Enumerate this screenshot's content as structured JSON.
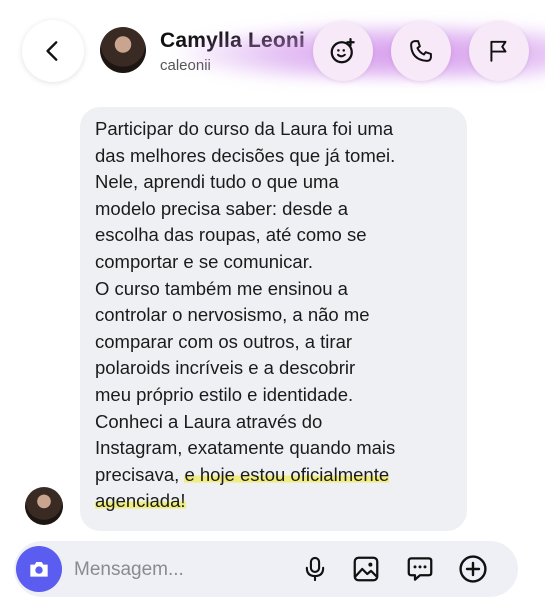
{
  "header": {
    "name": "Camylla Leoni",
    "username": "caleonii"
  },
  "message": {
    "text": "Participar do curso da Laura foi uma\ndas melhores decisões que já tomei.\nNele, aprendi tudo o que uma\nmodelo precisa saber: desde a\nescolha das roupas, até como se\ncomportar e se comunicar.\nO curso também me ensinou a\ncontrolar o nervosismo, a não me\ncomparar com os outros, a tirar\npolaroids incríveis e a descobrir\nmeu próprio estilo e identidade.\nConheci a Laura através do\nInstagram, exatamente quando mais\nprecisava, ",
    "highlight": "e hoje estou oficialmente\nagenciada!"
  },
  "composer": {
    "placeholder": "Mensagem..."
  },
  "icons": {
    "back": "chevron-left-icon",
    "effects": "effects-icon",
    "call": "phone-icon",
    "report": "flag-icon",
    "camera": "camera-icon",
    "mic": "microphone-icon",
    "gallery": "image-icon",
    "sticker": "chat-bubble-icon",
    "add": "plus-circle-icon"
  },
  "colors": {
    "accent": "#5b5cf0",
    "highlight": "#f0ec5a",
    "bubble": "#eff0f4",
    "glow": "#c878e6"
  }
}
